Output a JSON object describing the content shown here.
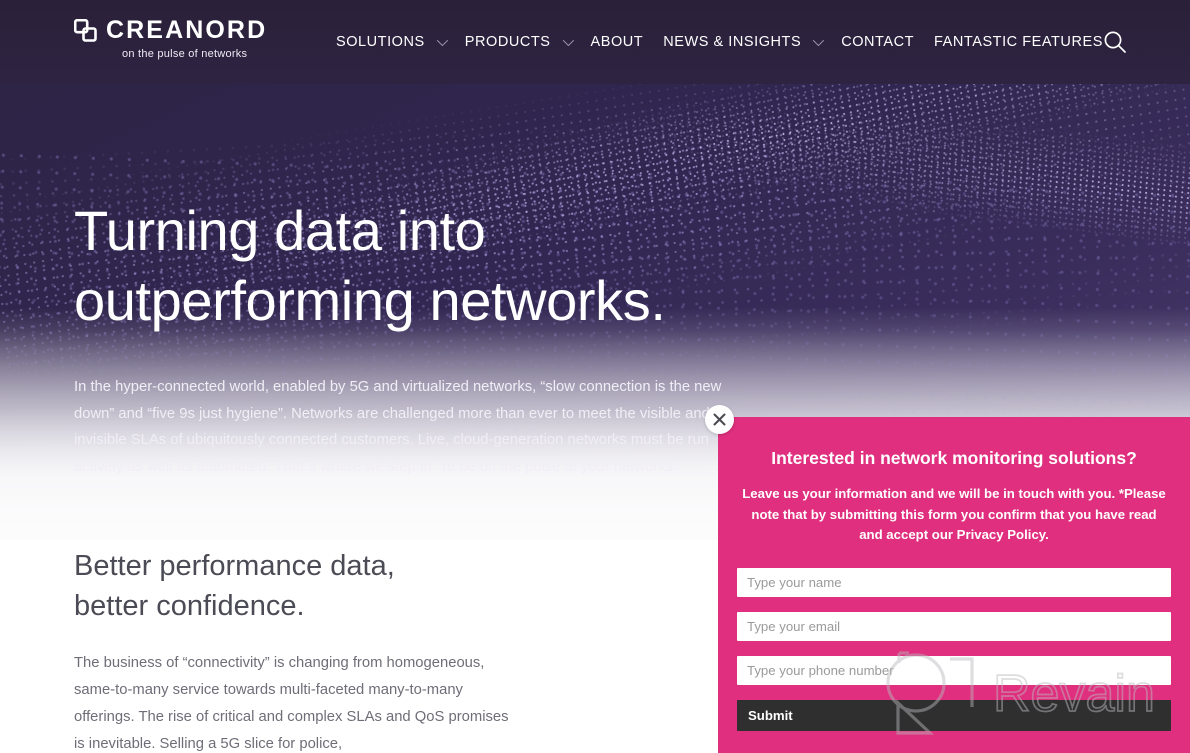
{
  "header": {
    "logo": {
      "icon": "overlapping-squares-logo-mark",
      "wordmark": "CREANORD",
      "tagline": "on the pulse of networks"
    },
    "nav_items": [
      {
        "label": "SOLUTIONS",
        "has_dropdown": true
      },
      {
        "label": "PRODUCTS",
        "has_dropdown": true
      },
      {
        "label": "ABOUT",
        "has_dropdown": false
      },
      {
        "label": "NEWS & INSIGHTS",
        "has_dropdown": true
      },
      {
        "label": "CONTACT",
        "has_dropdown": false
      },
      {
        "label": "FANTASTIC FEATURES",
        "has_dropdown": false
      }
    ],
    "search_icon": "search-icon",
    "background_color": "#2e2442"
  },
  "hero": {
    "title_line1": "Turning data into",
    "title_line2": "outperforming networks.",
    "paragraph": "In the hyper-connected world, enabled by 5G and virtualized networks, “slow connection is the new down” and “five 9s just hygiene”. Networks are challenged more than ever to meet the visible and invisible SLAs of ubiquitously connected customers.  Live, cloud-generation networks must be run actively as well as automated. That´s where we step in. To be on the pulse of your networks.",
    "background": "dotted-wave-particle-field",
    "gradient_from": "#2d2343",
    "gradient_to": "#4b3d6e"
  },
  "section_two": {
    "title_line1": "Better performance data,",
    "title_line2": "better confidence.",
    "paragraph": "The business of “connectivity”  is changing from homogeneous, same-to-many service towards multi-faceted many-to-many offerings. The rise of critical and complex SLAs and QoS promises is inevitable. Selling a 5G slice for police,"
  },
  "popup": {
    "close_icon": "close-icon",
    "heading": "Interested in network monitoring solutions?",
    "subtext": "Leave us your information and we will be in touch with you. *Please note that by submitting this form you confirm that you have read and accept our Privacy Policy.",
    "fields": [
      {
        "name": "name",
        "placeholder": "Type your name",
        "value": ""
      },
      {
        "name": "email",
        "placeholder": "Type your email",
        "value": ""
      },
      {
        "name": "phone",
        "placeholder": "Type your phone number",
        "value": ""
      }
    ],
    "submit_label": "Submit",
    "background_color": "#df2f7e",
    "submit_color": "#2f2f30"
  },
  "watermark": {
    "text": "Revain",
    "icon": "revain-logo-icon"
  }
}
